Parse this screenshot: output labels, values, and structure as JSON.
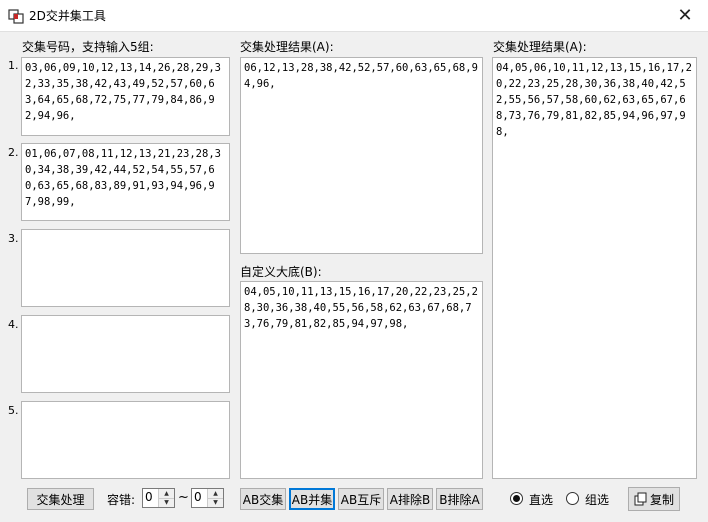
{
  "window": {
    "title": "2D交并集工具",
    "close_glyph": "✕"
  },
  "left": {
    "header": "交集号码，支持输入5组:",
    "groups": [
      {
        "num": "1.",
        "text": "03,06,09,10,12,13,14,26,28,29,32,33,35,38,42,43,49,52,57,60,63,64,65,68,72,75,77,79,84,86,92,94,96,"
      },
      {
        "num": "2.",
        "text": "01,06,07,08,11,12,13,21,23,28,30,34,38,39,42,44,52,54,55,57,60,63,65,68,83,89,91,93,94,96,97,98,99,"
      },
      {
        "num": "3.",
        "text": ""
      },
      {
        "num": "4.",
        "text": ""
      },
      {
        "num": "5.",
        "text": ""
      }
    ]
  },
  "middle": {
    "result_header": "交集处理结果(A):",
    "result_text": "06,12,13,28,38,42,52,57,60,63,65,68,94,96,",
    "custom_header": "自定义大底(B):",
    "custom_text": "04,05,10,11,13,15,16,17,20,22,23,25,28,30,36,38,40,55,56,58,62,63,67,68,73,76,79,81,82,85,94,97,98,"
  },
  "right": {
    "header": "交集处理结果(A):",
    "text": "04,05,06,10,11,12,13,15,16,17,20,22,23,25,28,30,36,38,40,42,52,55,56,57,58,60,62,63,65,67,68,73,76,79,81,82,85,94,96,97,98,"
  },
  "bottom": {
    "process_button": "交集处理",
    "tolerance_label": "容错:",
    "tol_min": "0",
    "tol_sep": "~",
    "tol_max": "0",
    "ops": [
      "AB交集",
      "AB并集",
      "AB互斥",
      "A排除B",
      "B排除A"
    ],
    "radio_direct": "直选",
    "radio_group": "组选",
    "copy_button": "复制"
  }
}
